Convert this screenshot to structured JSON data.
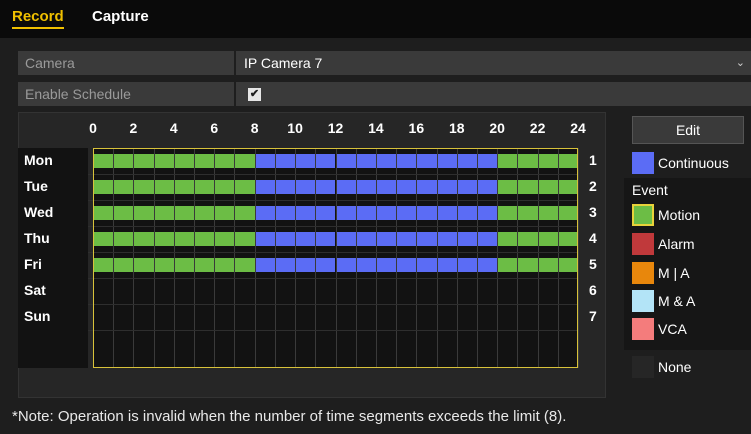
{
  "tabs": [
    {
      "label": "Record",
      "active": true
    },
    {
      "label": "Capture",
      "active": false
    }
  ],
  "form": {
    "camera_label": "Camera",
    "camera_value": "IP Camera 7",
    "enable_label": "Enable Schedule",
    "enable_checked": true,
    "enable_check_glyph": "✔"
  },
  "schedule": {
    "hours": [
      "0",
      "2",
      "4",
      "6",
      "8",
      "10",
      "12",
      "14",
      "16",
      "18",
      "20",
      "22",
      "24"
    ],
    "days": [
      {
        "label": "Mon",
        "num": "1",
        "segments": [
          {
            "from": 0,
            "to": 8,
            "type": "motion"
          },
          {
            "from": 8,
            "to": 20,
            "type": "continuous"
          },
          {
            "from": 20,
            "to": 24,
            "type": "motion"
          }
        ]
      },
      {
        "label": "Tue",
        "num": "2",
        "segments": [
          {
            "from": 0,
            "to": 8,
            "type": "motion"
          },
          {
            "from": 8,
            "to": 20,
            "type": "continuous"
          },
          {
            "from": 20,
            "to": 24,
            "type": "motion"
          }
        ]
      },
      {
        "label": "Wed",
        "num": "3",
        "segments": [
          {
            "from": 0,
            "to": 8,
            "type": "motion"
          },
          {
            "from": 8,
            "to": 20,
            "type": "continuous"
          },
          {
            "from": 20,
            "to": 24,
            "type": "motion"
          }
        ]
      },
      {
        "label": "Thu",
        "num": "4",
        "segments": [
          {
            "from": 0,
            "to": 8,
            "type": "motion"
          },
          {
            "from": 8,
            "to": 20,
            "type": "continuous"
          },
          {
            "from": 20,
            "to": 24,
            "type": "motion"
          }
        ]
      },
      {
        "label": "Fri",
        "num": "5",
        "segments": [
          {
            "from": 0,
            "to": 8,
            "type": "motion"
          },
          {
            "from": 8,
            "to": 20,
            "type": "continuous"
          },
          {
            "from": 20,
            "to": 24,
            "type": "motion"
          }
        ]
      },
      {
        "label": "Sat",
        "num": "6",
        "segments": []
      },
      {
        "label": "Sun",
        "num": "7",
        "segments": []
      }
    ]
  },
  "legend": {
    "edit_label": "Edit",
    "continuous_label": "Continuous",
    "event_title": "Event",
    "motion_label": "Motion",
    "alarm_label": "Alarm",
    "m_or_a_label": "M | A",
    "m_and_a_label": "M & A",
    "vca_label": "VCA",
    "none_label": "None"
  },
  "colors": {
    "accent": "#f0c000",
    "continuous": "#5b6cf5",
    "motion": "#6cbd45",
    "alarm": "#c0393b",
    "m_or_a": "#e8870c",
    "m_and_a": "#b3e4f7",
    "vca": "#f47c7c",
    "none": "#262626"
  },
  "note": "*Note: Operation is invalid when the number of time segments exceeds the limit (8)."
}
